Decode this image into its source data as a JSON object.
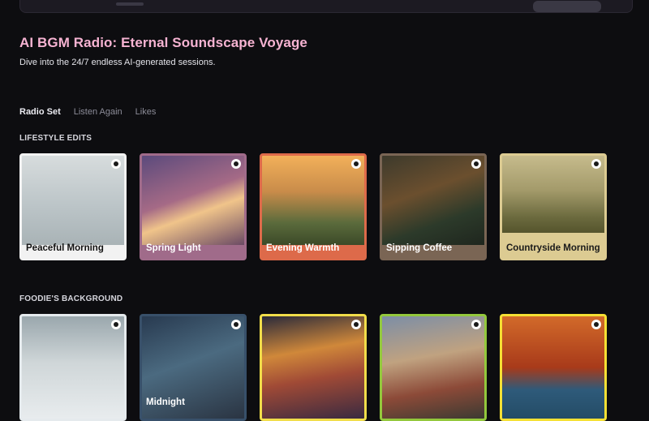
{
  "header": {
    "title": "AI BGM Radio: Eternal Soundscape Voyage",
    "subtitle": "Dive into the 24/7 endless AI-generated sessions."
  },
  "tabs": [
    {
      "label": "Radio Set",
      "active": true
    },
    {
      "label": "Listen Again",
      "active": false
    },
    {
      "label": "Likes",
      "active": false
    }
  ],
  "sections": [
    {
      "label": "LIFESTYLE EDITS",
      "cards": [
        {
          "title": "Peaceful Morning"
        },
        {
          "title": "Spring Light"
        },
        {
          "title": "Evening Warmth"
        },
        {
          "title": "Sipping Coffee"
        },
        {
          "title": "Countryside Morning"
        }
      ]
    },
    {
      "label": "FOODIE'S BACKGROUND",
      "cards": [
        {
          "title": ""
        },
        {
          "title": "Midnight"
        },
        {
          "title": ""
        },
        {
          "title": ""
        },
        {
          "title": ""
        }
      ]
    }
  ],
  "icons": {
    "badge": "ai-badge-icon"
  }
}
